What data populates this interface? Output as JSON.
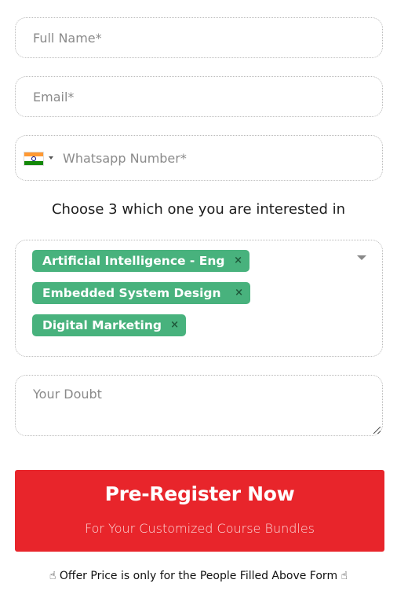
{
  "form": {
    "full_name": {
      "placeholder": "Full Name*",
      "value": ""
    },
    "email": {
      "placeholder": "Email*",
      "value": ""
    },
    "phone": {
      "placeholder": "Whatsapp Number*",
      "value": "",
      "country_flag": "india-flag-icon"
    },
    "question": "Choose 3 which one you are interested in",
    "courses": {
      "selected": [
        {
          "label": "Artificial Intelligence - Eng",
          "remove": "×"
        },
        {
          "label": "Embedded System Design",
          "remove": "×"
        },
        {
          "label": "Digital Marketing",
          "remove": "×"
        }
      ],
      "tag_color": "#48b27d"
    },
    "doubt": {
      "placeholder": "Your Doubt",
      "value": ""
    },
    "submit": {
      "title": "Pre-Register Now",
      "subtitle": "For Your Customized Course Bundles",
      "color": "#e8252b"
    },
    "note": {
      "icon_left": "☝",
      "text": "Offer Price is only for the People Filled Above Form",
      "icon_right": "☝"
    }
  }
}
